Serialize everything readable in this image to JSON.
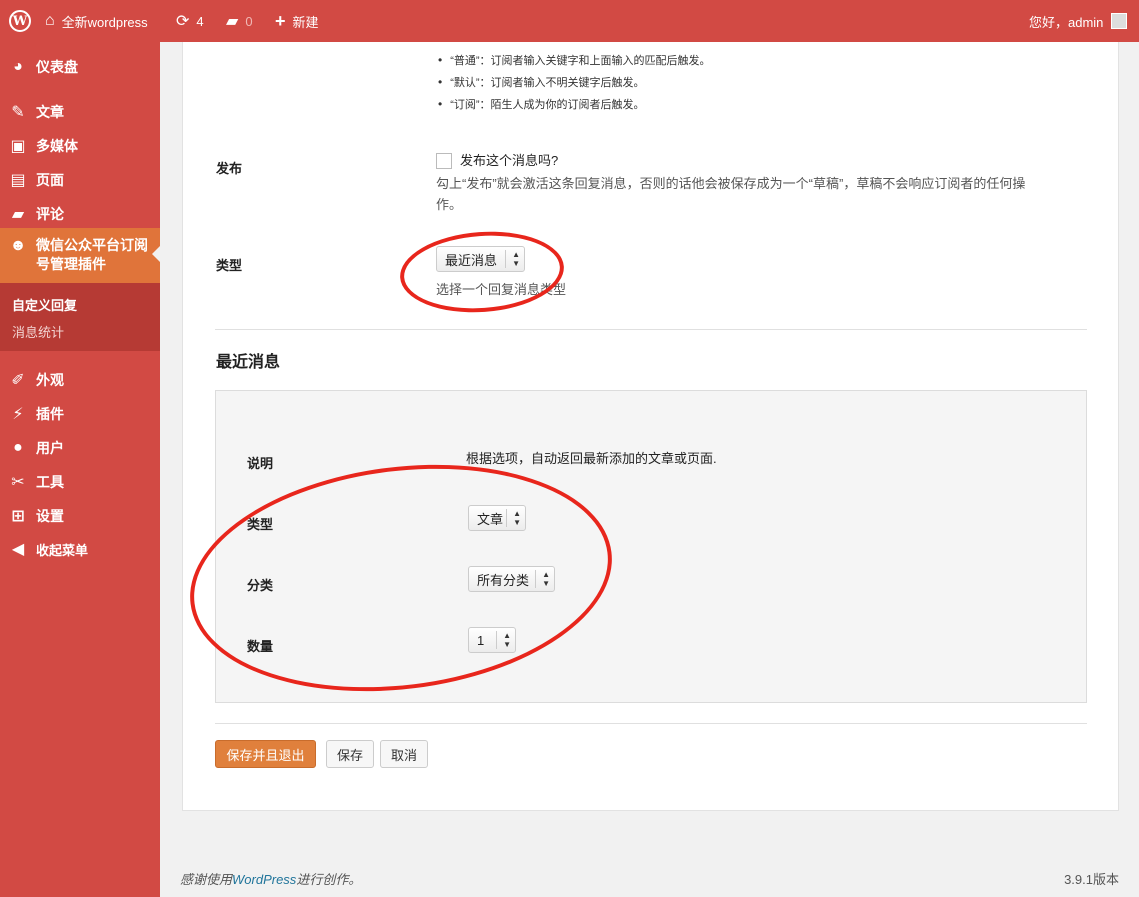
{
  "adminbar": {
    "site_name": "全新wordpress",
    "updates_count": "4",
    "comments_count": "0",
    "new_label": "新建",
    "greeting": "您好，admin"
  },
  "sidebar": {
    "items": [
      {
        "label": "仪表盘",
        "icon": "dashboard-icon"
      },
      {
        "label": "文章",
        "icon": "pin-icon"
      },
      {
        "label": "多媒体",
        "icon": "media-icon"
      },
      {
        "label": "页面",
        "icon": "page-icon"
      },
      {
        "label": "评论",
        "icon": "comment-icon"
      },
      {
        "label": "微信公众平台订阅号管理插件",
        "icon": "plugin-cat-icon"
      },
      {
        "label": "外观",
        "icon": "brush-icon"
      },
      {
        "label": "插件",
        "icon": "plug-icon"
      },
      {
        "label": "用户",
        "icon": "user-icon"
      },
      {
        "label": "工具",
        "icon": "wrench-icon"
      },
      {
        "label": "设置",
        "icon": "settings-icon"
      },
      {
        "label": "收起菜单",
        "icon": "collapse-icon"
      }
    ],
    "submenu": [
      {
        "label": "自定义回复"
      },
      {
        "label": "消息统计"
      }
    ]
  },
  "form": {
    "bullets": [
      "“普通”：订阅者输入关键字和上面输入的匹配后触发。",
      "“默认”：订阅者输入不明关键字后触发。",
      "“订阅”：陌生人成为你的订阅者后触发。"
    ],
    "publish": {
      "label": "发布",
      "checkbox_label": "发布这个消息吗?",
      "desc_line1": "勾上“发布”就会激活这条回复消息，否则的话他会被保存成为一个“草稿”，草稿不会响应订阅者的任何操",
      "desc_line2": "作。"
    },
    "type": {
      "label": "类型",
      "selected": "最近消息",
      "desc": "选择一个回复消息类型"
    }
  },
  "recent": {
    "title": "最近消息",
    "desc_label": "说明",
    "desc_text": "根据选项，自动返回最新添加的文章或页面.",
    "type_label": "类型",
    "type_selected": "文章",
    "category_label": "分类",
    "category_selected": "所有分类",
    "count_label": "数量",
    "count_selected": "1"
  },
  "buttons": {
    "save_exit": "保存并且退出",
    "save": "保存",
    "cancel": "取消"
  },
  "footer": {
    "prefix": "感谢使用",
    "link": "WordPress",
    "suffix": "进行创作。",
    "version": "3.9.1版本"
  },
  "colors": {
    "brand": "#d24a44",
    "current_menu": "#e0743a",
    "primary_button": "#e0803c",
    "annotation": "#e8261c"
  }
}
